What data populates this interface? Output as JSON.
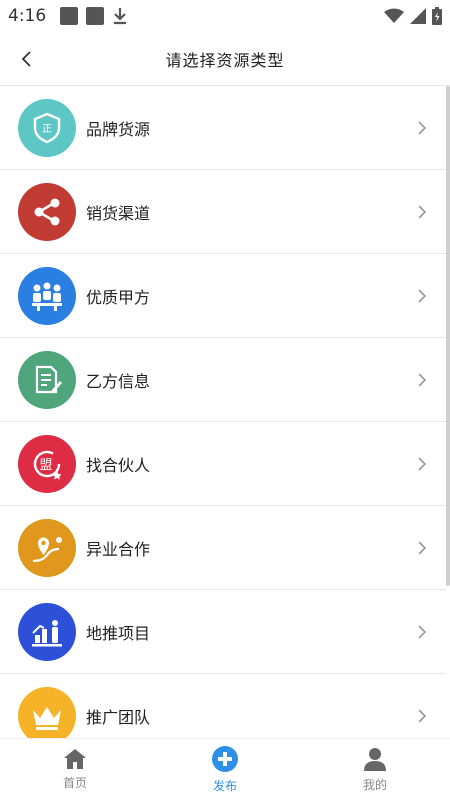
{
  "status_bar": {
    "time": "4:16"
  },
  "header": {
    "title": "请选择资源类型",
    "back_icon": "chevron-left-icon"
  },
  "list": [
    {
      "label": "品牌货源",
      "color": "#5cc7c5",
      "icon": "shield-badge-icon"
    },
    {
      "label": "销货渠道",
      "color": "#c13b32",
      "icon": "share-nodes-icon"
    },
    {
      "label": "优质甲方",
      "color": "#2a7fe0",
      "icon": "meeting-people-icon"
    },
    {
      "label": "乙方信息",
      "color": "#4fa57c",
      "icon": "document-edit-icon"
    },
    {
      "label": "找合伙人",
      "color": "#de2c45",
      "icon": "alliance-badge-icon"
    },
    {
      "label": "异业合作",
      "color": "#e0981c",
      "icon": "route-pin-icon"
    },
    {
      "label": "地推项目",
      "color": "#2d50d8",
      "icon": "growth-bars-icon"
    },
    {
      "label": "推广团队",
      "color": "#f6b328",
      "icon": "crown-icon"
    }
  ],
  "tabbar": [
    {
      "label": "首页",
      "icon": "home-icon",
      "active": false
    },
    {
      "label": "发布",
      "icon": "plus-circle-icon",
      "active": true,
      "color": "#2f8fe8"
    },
    {
      "label": "我的",
      "icon": "user-icon",
      "active": false
    }
  ]
}
